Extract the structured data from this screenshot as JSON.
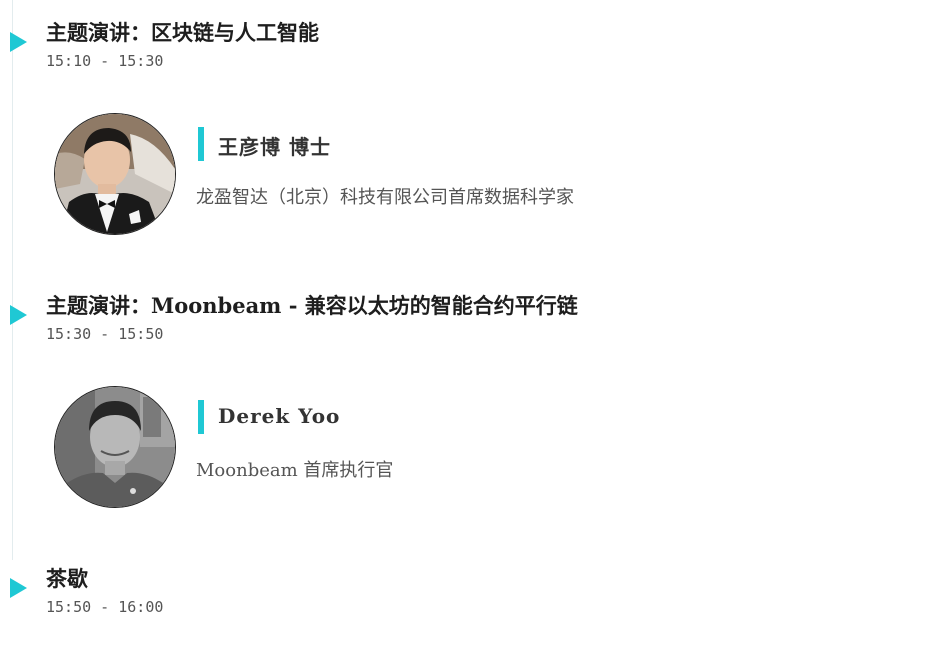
{
  "colors": {
    "accent": "#1fc8d4",
    "title_text": "#1e1e1e",
    "secondary_text": "#555555"
  },
  "sessions": [
    {
      "title": "主题演讲：区块链与人工智能",
      "time": "15:10 - 15:30",
      "speaker": {
        "name": "王彦博 博士",
        "title": "龙盈智达（北京）科技有限公司首席数据科学家",
        "avatar": "speaker-photo-color"
      }
    },
    {
      "title": "主题演讲：Moonbeam - 兼容以太坊的智能合约平行链",
      "time": "15:30 - 15:50",
      "speaker": {
        "name": "Derek Yoo",
        "title": "Moonbeam 首席执行官",
        "avatar": "speaker-photo-grayscale"
      }
    },
    {
      "title": "茶歇",
      "time": "15:50 - 16:00"
    }
  ]
}
